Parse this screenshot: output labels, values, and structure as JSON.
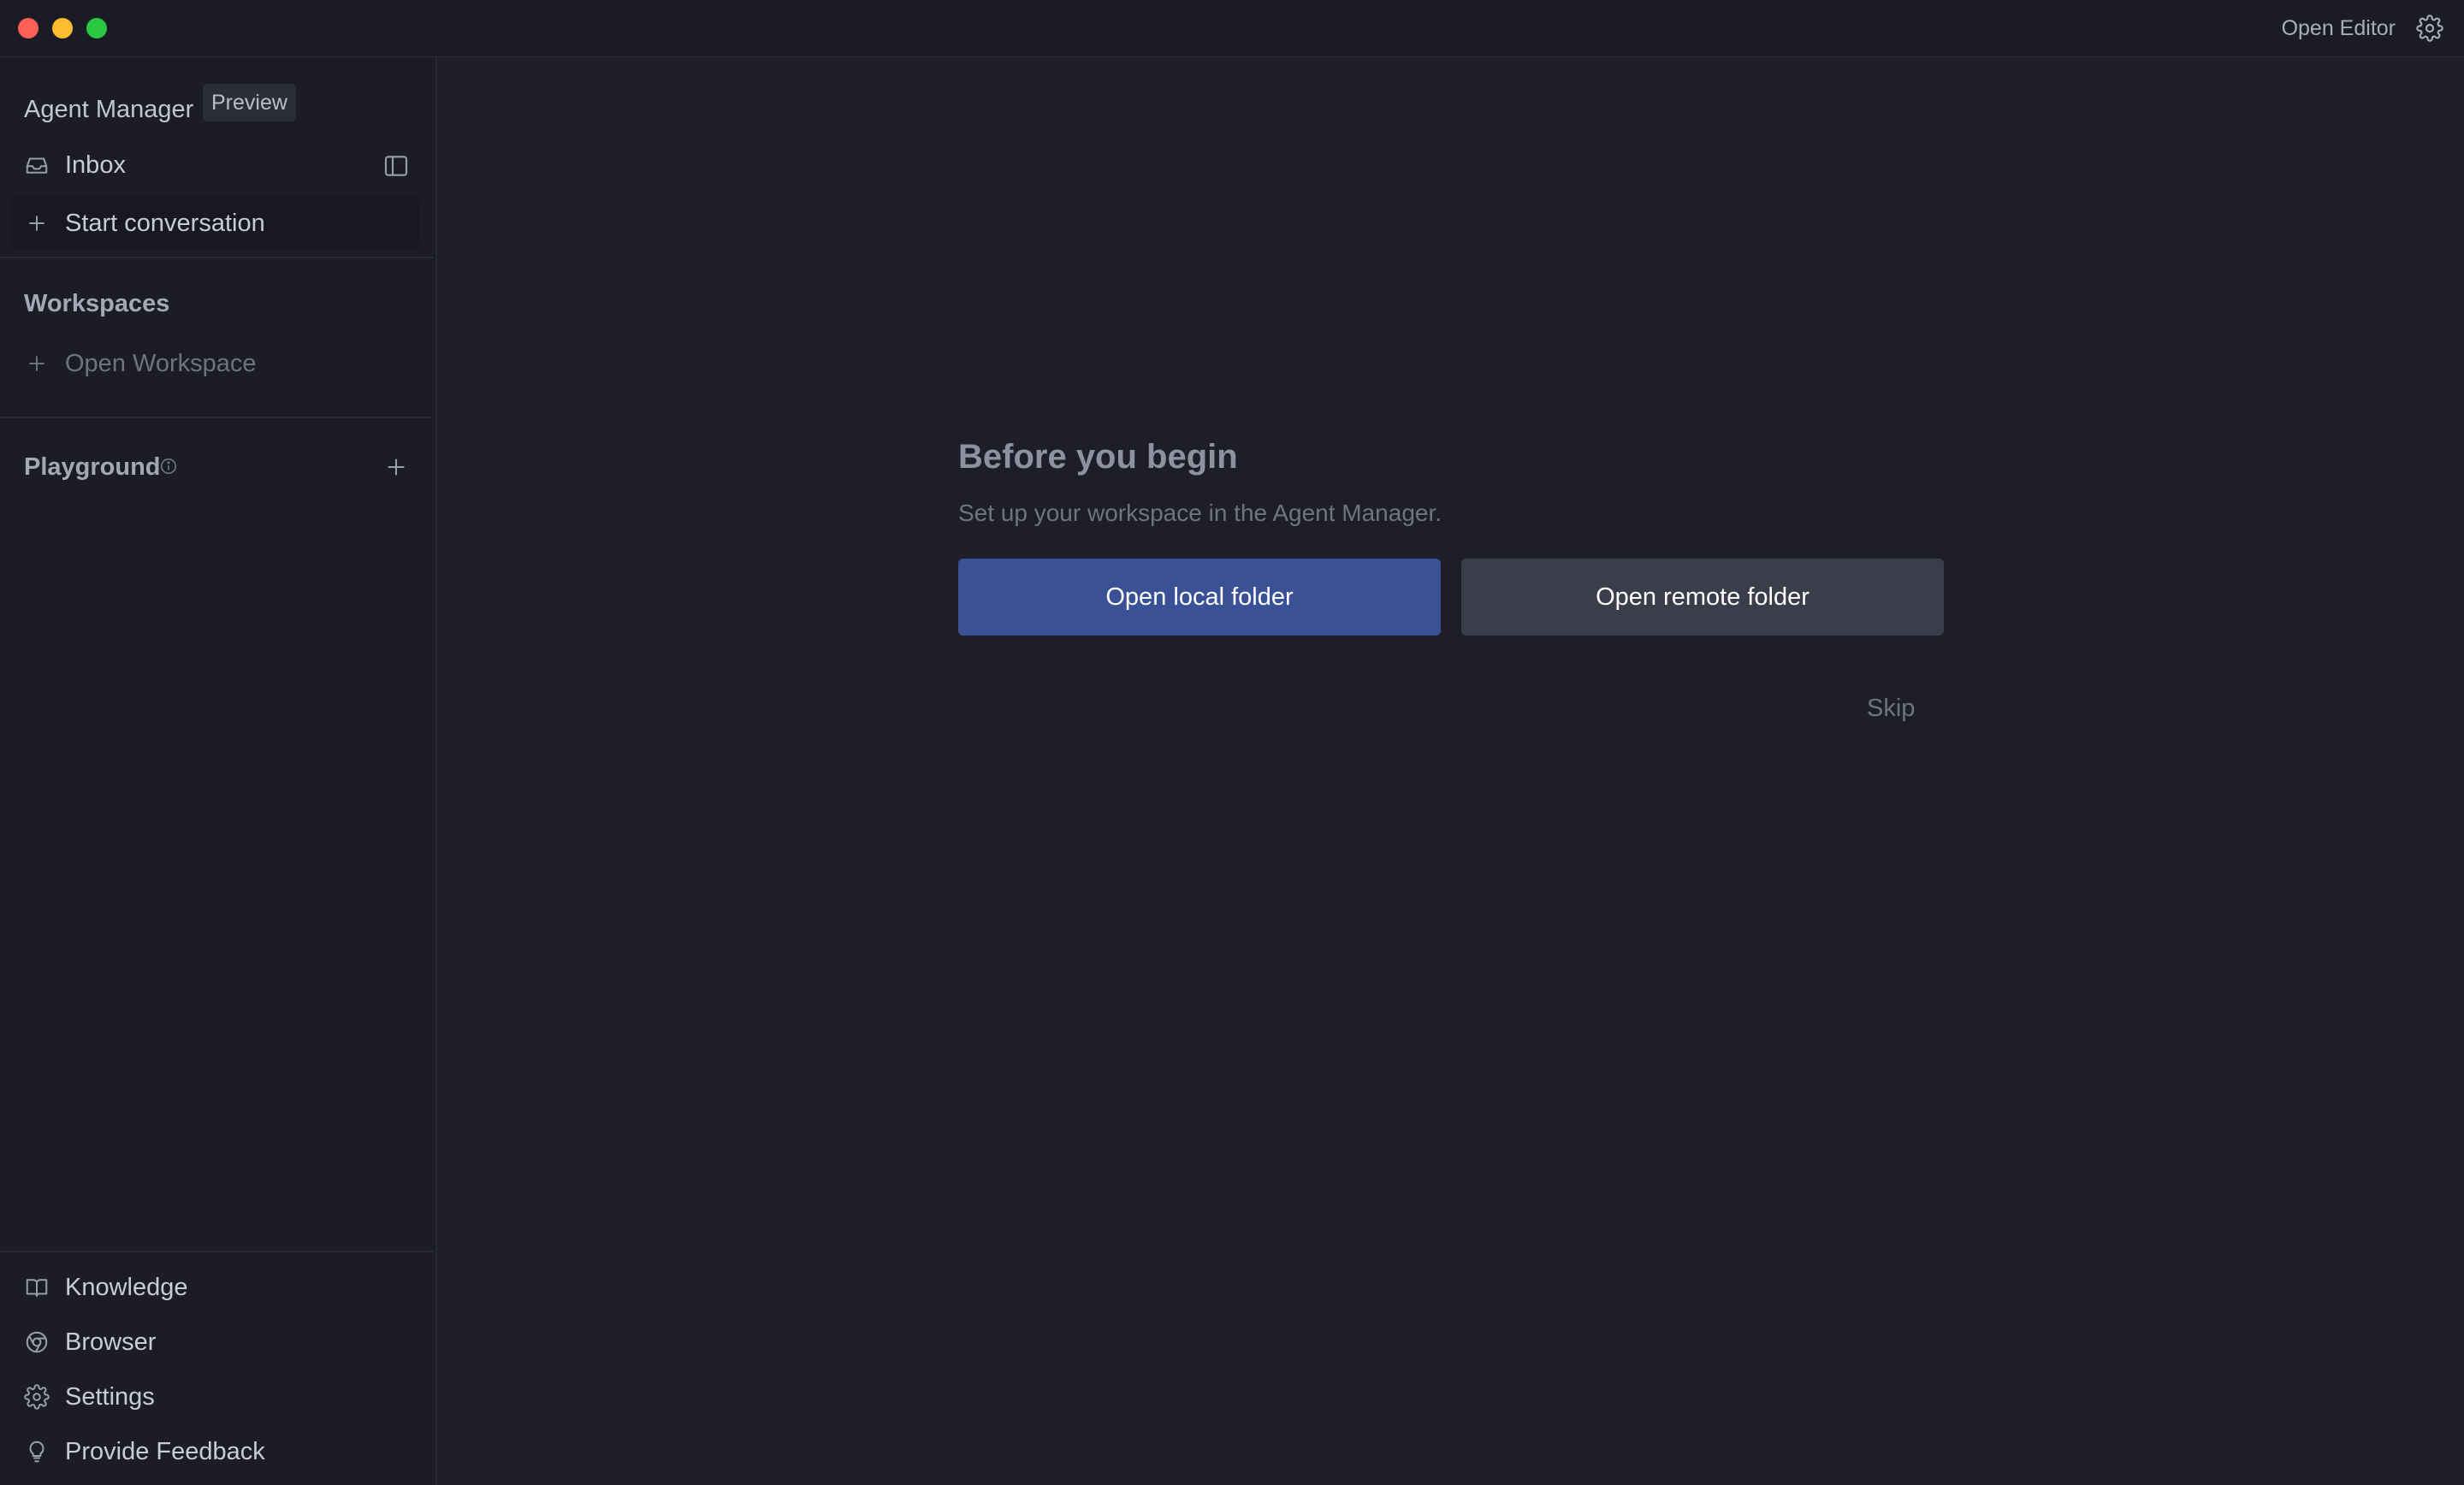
{
  "window": {
    "traffic_lights": [
      "close",
      "minimize",
      "maximize"
    ],
    "open_editor_label": "Open Editor"
  },
  "sidebar": {
    "app_title": "Agent Manager",
    "badge": "Preview",
    "inbox_label": "Inbox",
    "start_conversation_label": "Start conversation",
    "workspaces_label": "Workspaces",
    "open_workspace_label": "Open Workspace",
    "playground_label": "Playground",
    "footer_items": [
      {
        "label": "Knowledge",
        "icon": "book-icon"
      },
      {
        "label": "Browser",
        "icon": "chrome-icon"
      },
      {
        "label": "Settings",
        "icon": "gear-icon"
      },
      {
        "label": "Provide Feedback",
        "icon": "lightbulb-icon"
      }
    ]
  },
  "main": {
    "heading": "Before you begin",
    "subheading": "Set up your workspace in the Agent Manager.",
    "open_local_label": "Open local folder",
    "open_remote_label": "Open remote folder",
    "skip_label": "Skip"
  },
  "colors": {
    "background": "#1d1e28",
    "sidebar": "#1b1c26",
    "primary_button": "#3a5196",
    "secondary_button": "#3b3d4b"
  }
}
